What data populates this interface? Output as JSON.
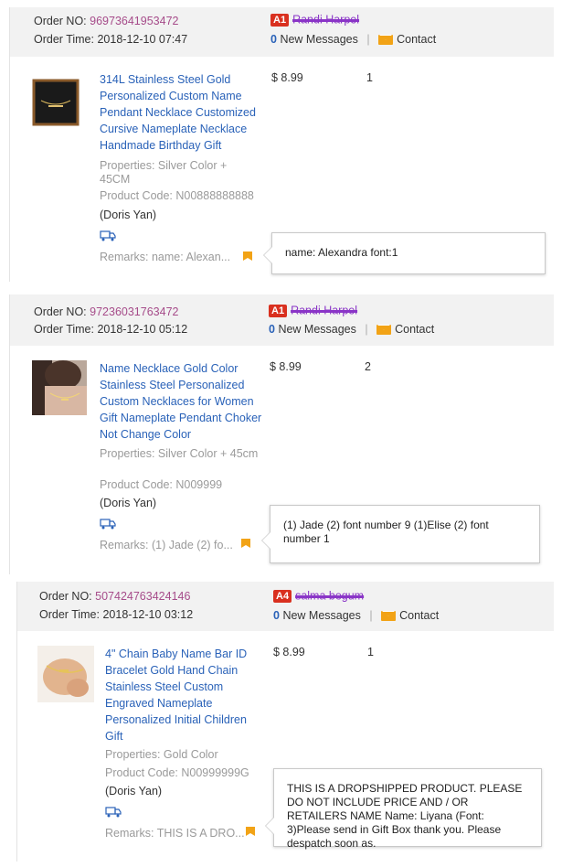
{
  "labels": {
    "order_no": "Order NO:",
    "order_time": "Order Time:",
    "new_messages": "New Messages",
    "contact": "Contact",
    "separator": "|"
  },
  "colors": {
    "link_blue": "#2a62b8",
    "order_no_purple": "#a64c8a",
    "level_badge_red": "#d9301f",
    "mail_orange": "#f2a316",
    "header_grey": "#f2f2f2"
  },
  "icons": {
    "mail": "envelope-icon",
    "truck": "truck-icon",
    "remark_flag": "bookmark-flag-icon"
  },
  "orders": [
    {
      "order_no": "96973641953472",
      "order_time": "2018-12-10 07:47",
      "buyer_level": "A1",
      "buyer_name": "Randi Harpel",
      "new_messages": "0",
      "product_title": "314L Stainless Steel Gold Personalized Custom Name Pendant Necklace Customized Cursive Nameplate Necklace Handmade Birthday Gift",
      "properties": "Properties: Silver Color + 45CM",
      "product_code": "Product Code: N00888888888",
      "customer": "(Doris Yan)",
      "remarks": "Remarks: name: Alexan...",
      "tooltip": "name: Alexandra font:1",
      "price": "$ 8.99",
      "quantity": "1"
    },
    {
      "order_no": "97236031763472",
      "order_time": "2018-12-10 05:12",
      "buyer_level": "A1",
      "buyer_name": "Randi Harpel",
      "new_messages": "0",
      "product_title": "Name Necklace Gold Color Stainless Steel Personalized Custom Necklaces for Women Gift Nameplate Pendant Choker Not Change Color",
      "properties": "Properties: Silver Color + 45cm",
      "product_code": "Product Code: N009999",
      "customer": "(Doris Yan)",
      "remarks": "Remarks: (1) Jade (2) fo...",
      "tooltip": "(1) Jade (2) font number 9 (1)Elise (2) font number 1",
      "price": "$ 8.99",
      "quantity": "2"
    },
    {
      "order_no": "507424763424146",
      "order_time": "2018-12-10 03:12",
      "buyer_level": "A4",
      "buyer_name": "salma begum",
      "new_messages": "0",
      "product_title": "4\" Chain Baby Name Bar ID Bracelet Gold Hand Chain Stainless Steel Custom Engraved Nameplate Personalized Initial Children Gift",
      "properties": "Properties: Gold Color",
      "product_code": "Product Code: N00999999G",
      "customer": "(Doris Yan)",
      "remarks": "Remarks: THIS IS A DRO...",
      "tooltip": "THIS IS A DROPSHIPPED PRODUCT. PLEASE DO NOT INCLUDE PRICE AND / OR RETAILERS NAME Name: Liyana (Font: 3)Please send in Gift Box thank you. Please despatch soon as.",
      "price": "$ 8.99",
      "quantity": "1"
    }
  ]
}
